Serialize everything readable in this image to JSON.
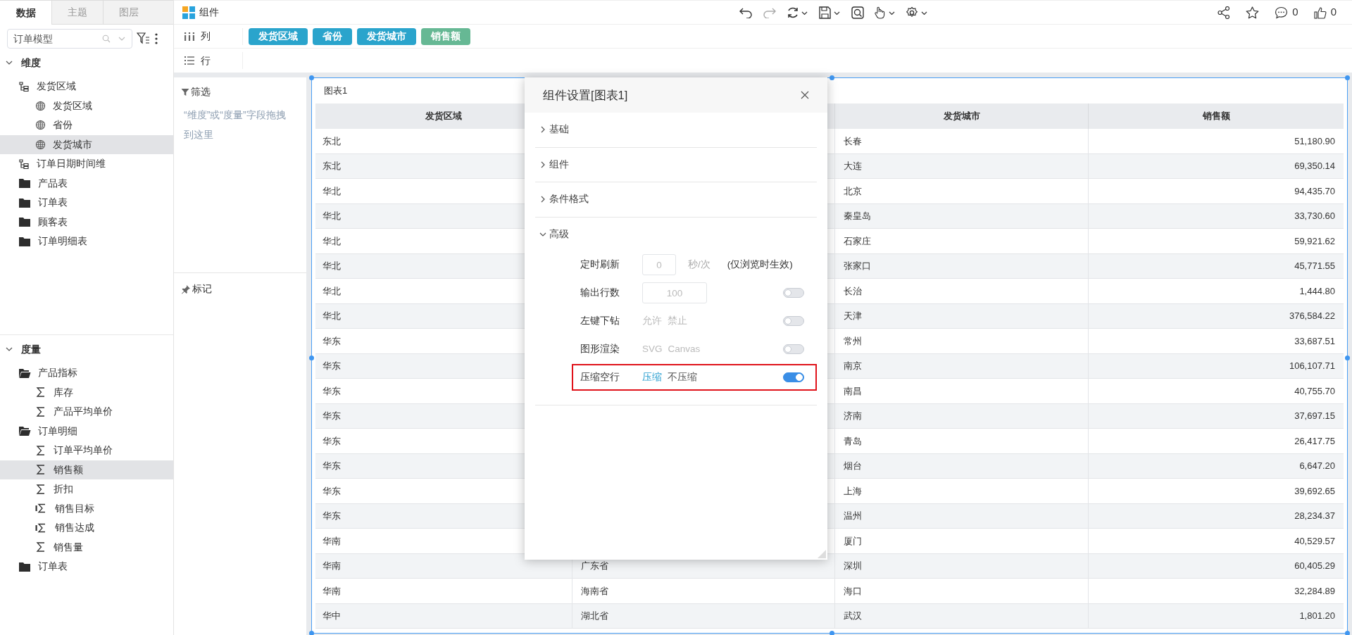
{
  "sidebar": {
    "tabs": [
      {
        "label": "数据",
        "selected": true
      },
      {
        "label": "主题",
        "selected": false
      },
      {
        "label": "图层",
        "selected": false
      }
    ],
    "model_select": {
      "value": "订单模型"
    },
    "sections": [
      {
        "title": "维度",
        "expanded": true,
        "items": [
          {
            "label": "发货区域",
            "kind": "hierarchy",
            "selected": false,
            "children": [
              {
                "label": "发货区域",
                "kind": "geo",
                "selected": false
              },
              {
                "label": "省份",
                "kind": "geo",
                "selected": false
              },
              {
                "label": "发货城市",
                "kind": "geo",
                "selected": true
              }
            ]
          },
          {
            "label": "订单日期时间维",
            "kind": "hierarchy",
            "selected": false
          },
          {
            "label": "产品表",
            "kind": "folder",
            "selected": false
          },
          {
            "label": "订单表",
            "kind": "folder",
            "selected": false
          },
          {
            "label": "顾客表",
            "kind": "folder",
            "selected": false
          },
          {
            "label": "订单明细表",
            "kind": "folder",
            "selected": false
          }
        ]
      },
      {
        "title": "度量",
        "expanded": true,
        "items": [
          {
            "label": "产品指标",
            "kind": "open-folder",
            "selected": false,
            "children": [
              {
                "label": "库存",
                "kind": "measure",
                "selected": false
              },
              {
                "label": "产品平均单价",
                "kind": "measure",
                "selected": false
              }
            ]
          },
          {
            "label": "订单明细",
            "kind": "open-folder",
            "selected": false,
            "children": [
              {
                "label": "订单平均单价",
                "kind": "measure",
                "selected": false
              },
              {
                "label": "销售额",
                "kind": "measure",
                "selected": true
              },
              {
                "label": "折扣",
                "kind": "measure",
                "selected": false
              },
              {
                "label": "销售目标",
                "kind": "target",
                "selected": false
              },
              {
                "label": "销售达成",
                "kind": "target",
                "selected": false
              },
              {
                "label": "销售量",
                "kind": "measure",
                "selected": false
              }
            ]
          },
          {
            "label": "订单表",
            "kind": "folder",
            "selected": false
          }
        ]
      }
    ]
  },
  "toolbar": {
    "title": "组件",
    "stats": [
      {
        "kind": "comment",
        "count": "0"
      },
      {
        "kind": "like",
        "count": "0"
      }
    ]
  },
  "columns_shelf": {
    "label": "列",
    "fields": [
      {
        "label": "发货区域",
        "color": "#2aa4cc"
      },
      {
        "label": "省份",
        "color": "#2aa4cc"
      },
      {
        "label": "发货城市",
        "color": "#2aa4cc"
      },
      {
        "label": "销售额",
        "color": "#66b894"
      }
    ]
  },
  "rows_shelf": {
    "label": "行"
  },
  "filter": {
    "title": "筛选",
    "hint": "“维度”或“度量”字段拖拽到这里"
  },
  "marks": {
    "title": "标记"
  },
  "chart": {
    "title": "图表1",
    "headers": {
      "region": "发货区域",
      "city": "发货城市",
      "sales": "销售额"
    },
    "rows": [
      {
        "region": "东北",
        "city": "长春",
        "sales": "51,180.90"
      },
      {
        "region": "东北",
        "city": "大连",
        "sales": "69,350.14"
      },
      {
        "region": "华北",
        "city": "北京",
        "sales": "94,435.70"
      },
      {
        "region": "华北",
        "city": "秦皇岛",
        "sales": "33,730.60"
      },
      {
        "region": "华北",
        "city": "石家庄",
        "sales": "59,921.62"
      },
      {
        "region": "华北",
        "city": "张家口",
        "sales": "45,771.55"
      },
      {
        "region": "华北",
        "city": "长治",
        "sales": "1,444.80"
      },
      {
        "region": "华北",
        "city": "天津",
        "sales": "376,584.22"
      },
      {
        "region": "华东",
        "city": "常州",
        "sales": "33,687.51"
      },
      {
        "region": "华东",
        "city": "南京",
        "sales": "106,107.71"
      },
      {
        "region": "华东",
        "city": "南昌",
        "sales": "40,755.70"
      },
      {
        "region": "华东",
        "city": "济南",
        "sales": "37,697.15"
      },
      {
        "region": "华东",
        "city": "青岛",
        "sales": "26,417.75"
      },
      {
        "region": "华东",
        "city": "烟台",
        "sales": "6,647.20"
      },
      {
        "region": "华东",
        "city": "上海",
        "sales": "39,692.65"
      },
      {
        "region": "华东",
        "city": "温州",
        "sales": "28,234.37"
      },
      {
        "region": "华南",
        "city": "厦门",
        "sales": "40,529.57"
      },
      {
        "region": "华南",
        "province": "广东省",
        "city": "深圳",
        "sales": "60,405.29"
      },
      {
        "region": "华南",
        "province": "海南省",
        "city": "海口",
        "sales": "32,284.89"
      },
      {
        "region": "华中",
        "province": "湖北省",
        "city": "武汉",
        "sales": "1,801.20"
      }
    ]
  },
  "dialog": {
    "title": "组件设置[图表1]",
    "sections": [
      {
        "title": "基础",
        "expanded": false
      },
      {
        "title": "组件",
        "expanded": false
      },
      {
        "title": "条件格式",
        "expanded": false
      },
      {
        "title": "高级",
        "expanded": true,
        "settings": [
          {
            "kind": "input",
            "label": "定时刷新",
            "placeholder": "0",
            "unit": "秒/次",
            "note": "(仅浏览时生效)"
          },
          {
            "kind": "input-toggle",
            "label": "输出行数",
            "placeholder": "100",
            "on": false
          },
          {
            "kind": "options",
            "label": "左键下钻",
            "on": false,
            "options": [
              {
                "label": "允许",
                "selected": false
              },
              {
                "label": "禁止",
                "selected": false
              }
            ]
          },
          {
            "kind": "options",
            "label": "图形渲染",
            "on": false,
            "options": [
              {
                "label": "SVG",
                "selected": false
              },
              {
                "label": "Canvas",
                "selected": false
              }
            ]
          },
          {
            "kind": "options",
            "label": "压缩空行",
            "on": true,
            "highlighted": true,
            "options": [
              {
                "label": "压缩",
                "selected": true
              },
              {
                "label": "不压缩",
                "selected": false
              }
            ]
          }
        ]
      }
    ]
  }
}
